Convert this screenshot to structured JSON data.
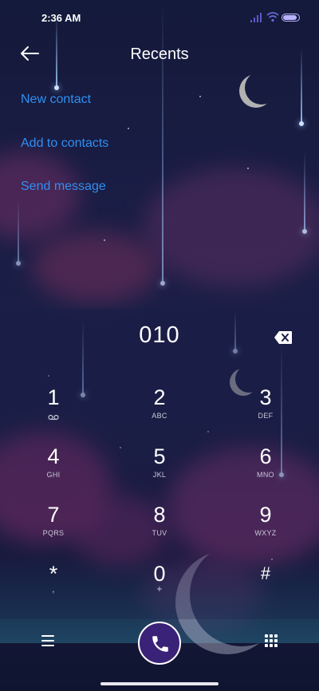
{
  "status_bar": {
    "time": "2:36 AM",
    "icons": [
      "signal-icon",
      "wifi-icon",
      "battery-icon"
    ]
  },
  "header": {
    "back_icon": "arrow-left-icon",
    "title": "Recents"
  },
  "actions": [
    {
      "label": "New contact"
    },
    {
      "label": "Add to contacts"
    },
    {
      "label": "Send message"
    }
  ],
  "dialer": {
    "number": "010",
    "delete_icon": "backspace-icon",
    "keys": [
      {
        "digit": "1",
        "letters": "",
        "icon": "voicemail-icon"
      },
      {
        "digit": "2",
        "letters": "ABC"
      },
      {
        "digit": "3",
        "letters": "DEF"
      },
      {
        "digit": "4",
        "letters": "GHI"
      },
      {
        "digit": "5",
        "letters": "JKL"
      },
      {
        "digit": "6",
        "letters": "MNO"
      },
      {
        "digit": "7",
        "letters": "PQRS"
      },
      {
        "digit": "8",
        "letters": "TUV"
      },
      {
        "digit": "9",
        "letters": "WXYZ"
      },
      {
        "digit": "*",
        "letters": ","
      },
      {
        "digit": "0",
        "letters": "+"
      },
      {
        "digit": "#",
        "letters": ""
      }
    ]
  },
  "bottom_bar": {
    "menu_icon": "menu-icon",
    "call_icon": "phone-icon",
    "keypad_icon": "keypad-icon"
  },
  "colors": {
    "accent": "#2f8ff2",
    "call_button": "#3a2278",
    "background": "#1a1d45"
  }
}
